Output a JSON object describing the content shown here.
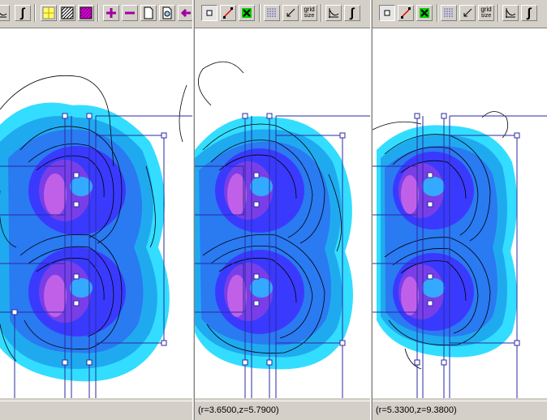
{
  "panes": [
    {
      "toolbar": {
        "integral_label": "∫"
      },
      "status": ""
    },
    {
      "toolbar": {
        "grid_size_label_1": "grid",
        "grid_size_label_2": "size",
        "integral_label": "∫"
      },
      "status": "(r=3.6500,z=5.7900)"
    },
    {
      "toolbar": {
        "grid_size_label_1": "grid",
        "grid_size_label_2": "size",
        "integral_label": "∫"
      },
      "status": "(r=5.3300,z=9.3800)"
    }
  ],
  "colors": {
    "density_levels": [
      "#33ddff",
      "#1faaf0",
      "#2a7af2",
      "#3a3aff",
      "#7a3ee8",
      "#c060e8",
      "#e070d8"
    ],
    "boundary_line": "#2a2aa0",
    "contour_line": "#000000"
  }
}
